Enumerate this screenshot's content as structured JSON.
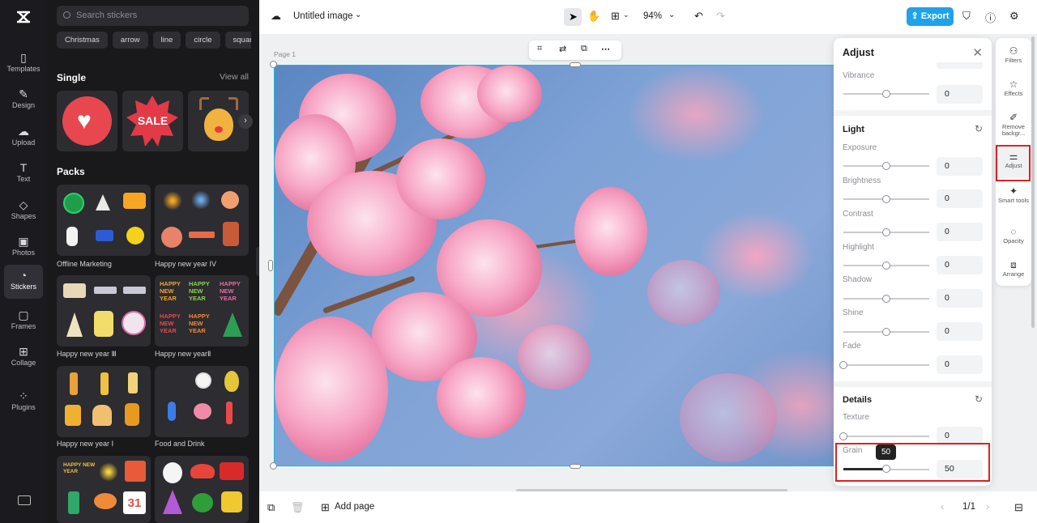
{
  "app": {
    "doc_title": "Untitled image",
    "zoom": "94%",
    "export_label": "Export",
    "add_page": "Add page",
    "page_count": "1/1",
    "page_label": "Page 1"
  },
  "leftrail": {
    "items": [
      {
        "label": "Templates",
        "icon": "templates-icon"
      },
      {
        "label": "Design",
        "icon": "design-icon"
      },
      {
        "label": "Upload",
        "icon": "upload-icon"
      },
      {
        "label": "Text",
        "icon": "text-icon"
      },
      {
        "label": "Shapes",
        "icon": "shapes-icon"
      },
      {
        "label": "Photos",
        "icon": "photos-icon"
      },
      {
        "label": "Stickers",
        "icon": "stickers-icon"
      },
      {
        "label": "Frames",
        "icon": "frames-icon"
      },
      {
        "label": "Collage",
        "icon": "collage-icon"
      },
      {
        "label": "Plugins",
        "icon": "plugins-icon"
      }
    ],
    "active": "Stickers"
  },
  "stickers": {
    "search_placeholder": "Search stickers",
    "chips": [
      "Christmas",
      "arrow",
      "line",
      "circle",
      "square"
    ],
    "single_title": "Single",
    "view_all": "View all",
    "sale_text": "SALE",
    "packs_title": "Packs",
    "packs": [
      "Offline Marketing",
      "Happy new year IV",
      "Happy new year Ⅲ",
      "Happy new yearⅡ",
      "Happy new year Ⅰ",
      "Food and Drink"
    ],
    "pack_words": {
      "happy": "HAPPY",
      "new": "NEW",
      "year": "YEAR",
      "happy_new_year": "HAPPY NEW YEAR",
      "calendar_day": "31"
    }
  },
  "adjust": {
    "title": "Adjust",
    "sections": {
      "light": "Light",
      "details": "Details"
    },
    "sliders": {
      "vibrance": {
        "label": "Vibrance",
        "value": "0"
      },
      "exposure": {
        "label": "Exposure",
        "value": "0"
      },
      "brightness": {
        "label": "Brightness",
        "value": "0"
      },
      "contrast": {
        "label": "Contrast",
        "value": "0"
      },
      "highlight": {
        "label": "Highlight",
        "value": "0"
      },
      "shadow": {
        "label": "Shadow",
        "value": "0"
      },
      "shine": {
        "label": "Shine",
        "value": "0"
      },
      "fade": {
        "label": "Fade",
        "value": "0"
      },
      "texture": {
        "label": "Texture",
        "value": "0"
      },
      "grain": {
        "label": "Grain",
        "value": "50"
      }
    },
    "tooltip": "50"
  },
  "rightrail": {
    "items": [
      {
        "label": "Filters",
        "icon": "filters-icon"
      },
      {
        "label": "Effects",
        "icon": "effects-icon"
      },
      {
        "label": "Remove backgr...",
        "icon": "remove-background-icon"
      },
      {
        "label": "Adjust",
        "icon": "adjust-icon"
      },
      {
        "label": "Smart tools",
        "icon": "smart-tools-icon"
      },
      {
        "label": "Opacity",
        "icon": "opacity-icon"
      },
      {
        "label": "Arrange",
        "icon": "arrange-icon"
      }
    ],
    "active": "Adjust"
  },
  "colors": {
    "accent": "#1fa2e8",
    "highlight_box": "#e02020",
    "selection": "#19b7d6"
  }
}
